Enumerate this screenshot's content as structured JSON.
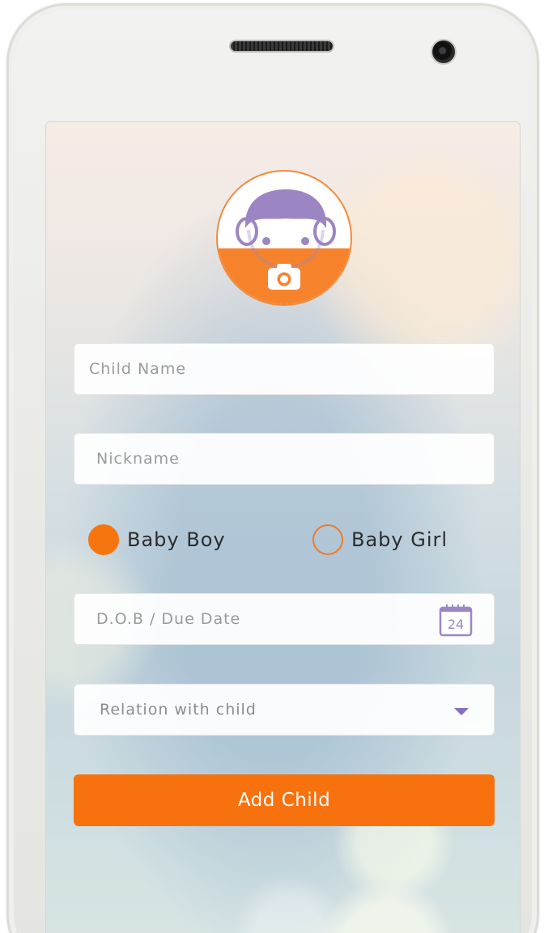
{
  "profile": {
    "avatar_icon": "baby-face-icon",
    "upload_icon": "camera-icon",
    "accent_color": "#f7720f",
    "avatar_hair_color": "#9b86c3"
  },
  "form": {
    "child_name": {
      "placeholder": "Child Name",
      "value": ""
    },
    "nickname": {
      "placeholder": "Nickname",
      "value": ""
    },
    "gender": {
      "options": [
        {
          "label": "Baby Boy",
          "selected": true
        },
        {
          "label": "Baby Girl",
          "selected": false
        }
      ]
    },
    "dob": {
      "placeholder": "D.O.B / Due Date",
      "value": "",
      "calendar_day": "24",
      "icon": "calendar-icon"
    },
    "relation": {
      "selected": "Relation with child",
      "icon": "chevron-down-icon"
    },
    "submit_label": "Add Child"
  }
}
